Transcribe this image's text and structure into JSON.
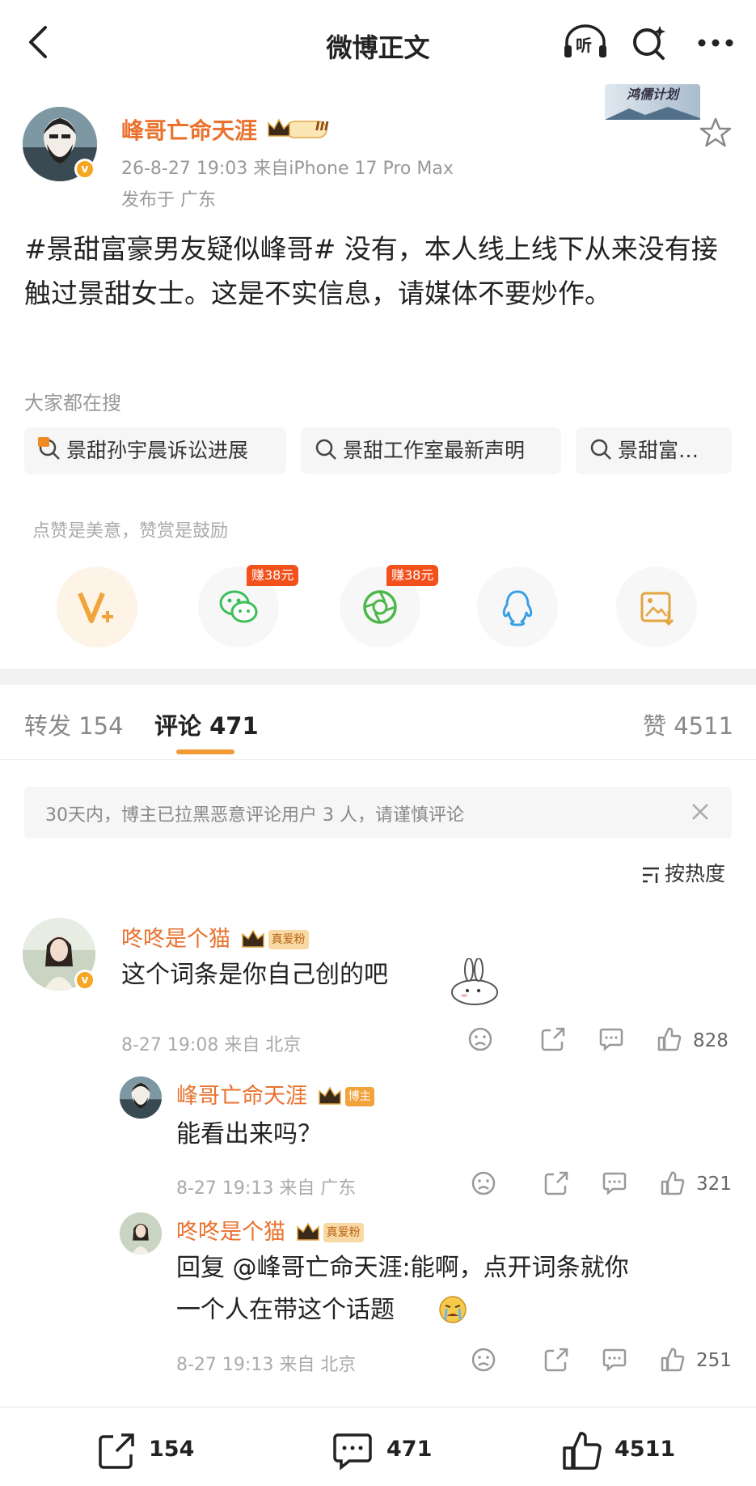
{
  "header": {
    "title": "微博正文",
    "listen_label": "听"
  },
  "post": {
    "author": "峰哥亡命天涯",
    "level_badge": "III",
    "avatar_badge": "v",
    "meta": "26-8-27 19:03   来自iPhone 17 Pro Max",
    "location": "发布于 广东",
    "promo": "鸿儒计划",
    "body": "#景甜富豪男友疑似峰哥# 没有，本人线上线下从来没有接触过景甜女士。这是不实信息，请媒体不要炒作。"
  },
  "search_section": {
    "hint": "大家都在搜",
    "chips": [
      {
        "label": "景甜孙宇晨诉讼进展",
        "icon": "hot-search-icon"
      },
      {
        "label": "景甜工作室最新声明",
        "icon": "search-icon"
      },
      {
        "label": "景甜富…",
        "icon": "search-icon"
      }
    ]
  },
  "reward": {
    "hint": "点赞是美意，赞赏是鼓励",
    "earn_tag": "赚38元",
    "buttons": [
      "vplus-icon",
      "wechat-icon",
      "moments-icon",
      "qq-icon",
      "save-image-icon"
    ]
  },
  "tabs": [
    {
      "label": "转发 154"
    },
    {
      "label": "评论 471"
    },
    {
      "label": "赞 4511"
    }
  ],
  "notice": {
    "text": "30天内，博主已拉黑恶意评论用户 3 人，请谨慎评论"
  },
  "sort": {
    "label": "按热度"
  },
  "comments": [
    {
      "name": "咚咚是个猫",
      "badge": "真爱粉",
      "text": "这个词条是你自己创的吧",
      "meta": "8-27 19:08 来自 北京",
      "likes": "828"
    },
    {
      "name": "峰哥亡命天涯",
      "badge": "博主",
      "text": "能看出来吗？",
      "meta": "8-27 19:13 来自 广东",
      "likes": "321"
    },
    {
      "name": "咚咚是个猫",
      "badge": "真爱粉",
      "text_line1": "回复 @峰哥亡命天涯:能啊，点开词条就你",
      "text_line2": "一个人在带这个话题",
      "meta": "8-27 19:13 来自 北京",
      "likes": "251"
    }
  ],
  "bottom_bar": {
    "repost": "154",
    "comment": "471",
    "like": "4511"
  },
  "colors": {
    "username": "#e9722e",
    "accent": "#f19a34",
    "earn_tag": "#f2511b"
  }
}
